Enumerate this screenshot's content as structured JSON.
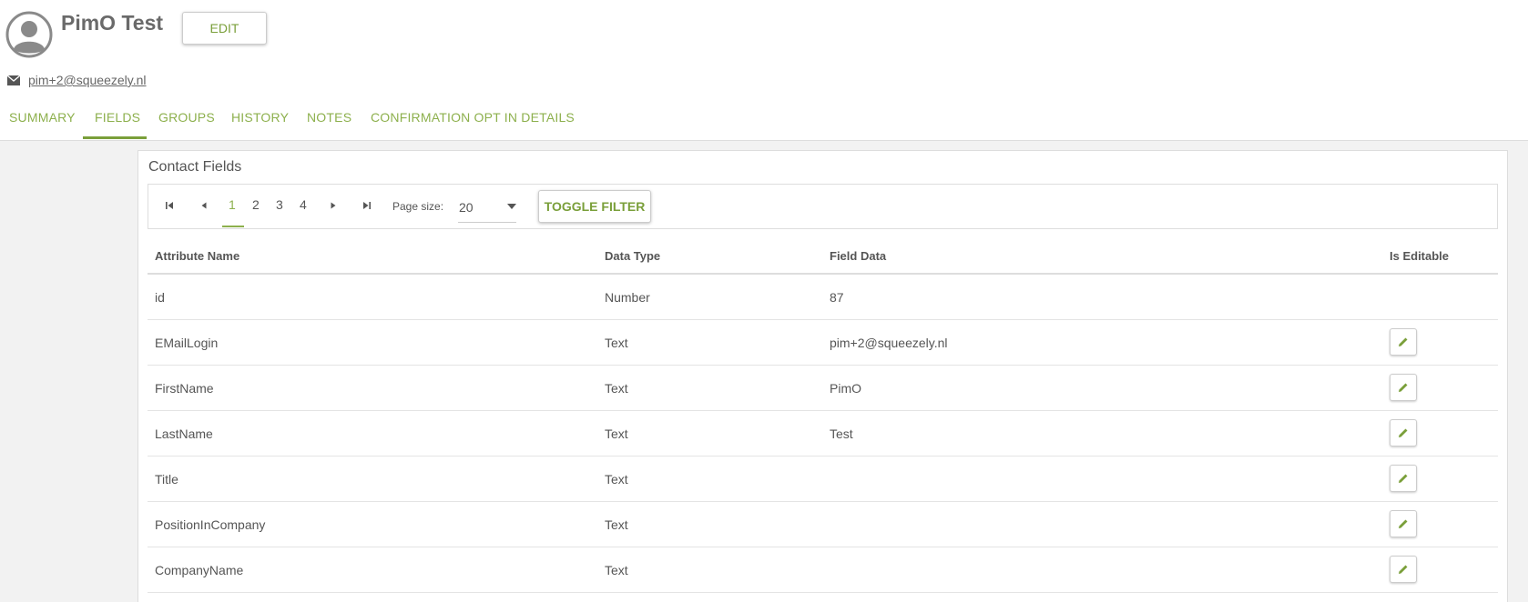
{
  "contact": {
    "name": "PimO Test",
    "email": "pim+2@squeezely.nl",
    "edit_label": "EDIT"
  },
  "tabs": [
    {
      "label": "SUMMARY"
    },
    {
      "label": "FIELDS"
    },
    {
      "label": "GROUPS"
    },
    {
      "label": "HISTORY"
    },
    {
      "label": "NOTES"
    },
    {
      "label": "CONFIRMATION OPT IN DETAILS"
    }
  ],
  "active_tab": "FIELDS",
  "panel": {
    "title": "Contact Fields",
    "pager": {
      "pages": [
        "1",
        "2",
        "3",
        "4"
      ],
      "current_page": "1",
      "page_size_label": "Page size:",
      "page_size": "20",
      "toggle_filter_label": "TOGGLE FILTER"
    },
    "columns": [
      "Attribute Name",
      "Data Type",
      "Field Data",
      "Is Editable"
    ],
    "rows": [
      {
        "attribute": "id",
        "type": "Number",
        "data": "87",
        "editable": false
      },
      {
        "attribute": "EMailLogin",
        "type": "Text",
        "data": "pim+2@squeezely.nl",
        "editable": true
      },
      {
        "attribute": "FirstName",
        "type": "Text",
        "data": "PimO",
        "editable": true
      },
      {
        "attribute": "LastName",
        "type": "Text",
        "data": "Test",
        "editable": true
      },
      {
        "attribute": "Title",
        "type": "Text",
        "data": "",
        "editable": true
      },
      {
        "attribute": "PositionInCompany",
        "type": "Text",
        "data": "",
        "editable": true
      },
      {
        "attribute": "CompanyName",
        "type": "Text",
        "data": "",
        "editable": true
      }
    ]
  },
  "colors": {
    "accent": "#8db04d",
    "accent_dark": "#7a9f3a"
  },
  "icons": {
    "avatar": "user-avatar-icon",
    "email": "envelope-icon",
    "first_page": "first-page-icon",
    "prev_page": "prev-page-icon",
    "next_page": "next-page-icon",
    "last_page": "last-page-icon",
    "caret": "caret-down-icon",
    "edit": "pencil-icon"
  }
}
